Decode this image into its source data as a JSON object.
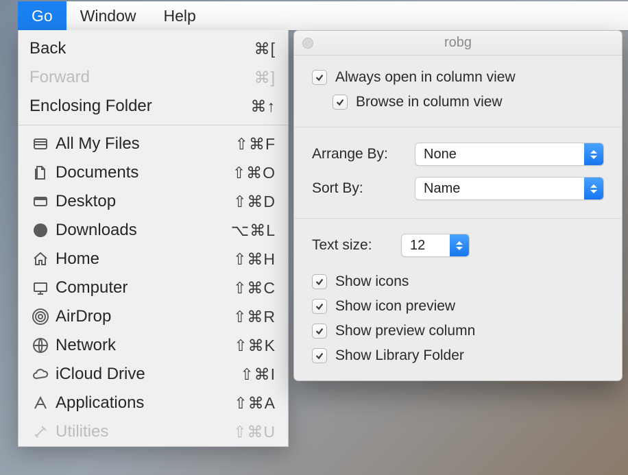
{
  "menubar": {
    "go": "Go",
    "window": "Window",
    "help": "Help"
  },
  "goMenu": {
    "back": {
      "label": "Back",
      "shortcut": "⌘["
    },
    "forward": {
      "label": "Forward",
      "shortcut": "⌘]"
    },
    "enclosing": {
      "label": "Enclosing Folder",
      "shortcut": "⌘↑"
    },
    "allMyFiles": {
      "label": "All My Files",
      "shortcut": "⇧⌘F"
    },
    "documents": {
      "label": "Documents",
      "shortcut": "⇧⌘O"
    },
    "desktop": {
      "label": "Desktop",
      "shortcut": "⇧⌘D"
    },
    "downloads": {
      "label": "Downloads",
      "shortcut": "⌥⌘L"
    },
    "home": {
      "label": "Home",
      "shortcut": "⇧⌘H"
    },
    "computer": {
      "label": "Computer",
      "shortcut": "⇧⌘C"
    },
    "airdrop": {
      "label": "AirDrop",
      "shortcut": "⇧⌘R"
    },
    "network": {
      "label": "Network",
      "shortcut": "⇧⌘K"
    },
    "icloud": {
      "label": "iCloud Drive",
      "shortcut": "⇧⌘I"
    },
    "applications": {
      "label": "Applications",
      "shortcut": "⇧⌘A"
    },
    "utilities": {
      "label": "Utilities",
      "shortcut": "⇧⌘U"
    }
  },
  "inspector": {
    "title": "robg",
    "alwaysOpenColumn": "Always open in column view",
    "browseColumn": "Browse in column view",
    "arrangeByLabel": "Arrange By:",
    "arrangeByValue": "None",
    "sortByLabel": "Sort By:",
    "sortByValue": "Name",
    "textSizeLabel": "Text size:",
    "textSizeValue": "12",
    "showIcons": "Show icons",
    "showIconPreview": "Show icon preview",
    "showPreviewColumn": "Show preview column",
    "showLibraryFolder": "Show Library Folder"
  }
}
